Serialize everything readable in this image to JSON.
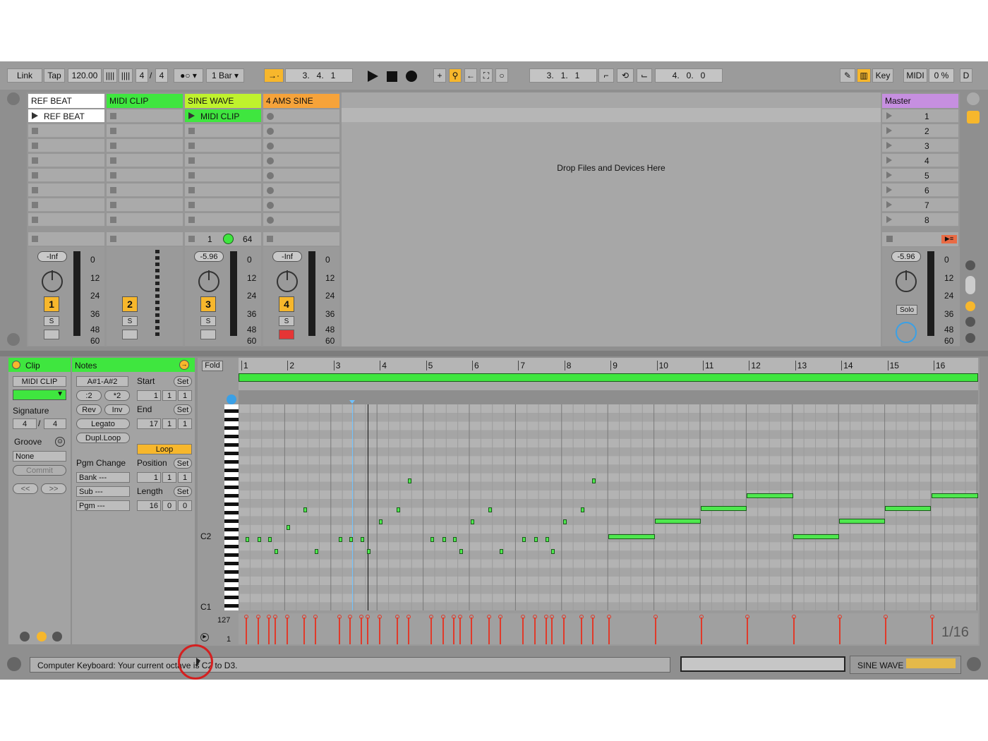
{
  "transport": {
    "link": "Link",
    "tap": "Tap",
    "tempo": "120.00",
    "sig_num": "4",
    "sig_den": "4",
    "quant": "1 Bar",
    "arrangement_pos": "3.   4.   1",
    "loop_start": "3.   1.   1",
    "loop_len": "4.   0.   0",
    "key": "Key",
    "midi": "MIDI",
    "cpu": "0 %",
    "d": "D"
  },
  "tracks": [
    {
      "name": "REF BEAT",
      "color": "#ffffff",
      "clip": "REF BEAT",
      "num": "1",
      "vol": "-Inf"
    },
    {
      "name": "MIDI CLIP",
      "color": "#3fe63f",
      "num": "2"
    },
    {
      "name": "SINE WAVE",
      "color": "#bff22d",
      "clip": "MIDI CLIP",
      "num": "3",
      "vol": "-5.96",
      "clipstop_a": "1",
      "clipstop_b": "64"
    },
    {
      "name": "4   AMS SINE",
      "color": "#f6a33a",
      "num": "4",
      "vol": "-Inf"
    }
  ],
  "drop_text": "Drop Files and Devices Here",
  "master": {
    "name": "Master",
    "color": "#c68fe0",
    "scenes": [
      "1",
      "2",
      "3",
      "4",
      "5",
      "6",
      "7",
      "8"
    ],
    "vol": "-5.96",
    "solo": "Solo"
  },
  "meter_scale": [
    "0",
    "12",
    "24",
    "36",
    "48",
    "60"
  ],
  "solo_label": "S",
  "clip_panel": {
    "title": "Clip",
    "name": "MIDI CLIP",
    "signature_label": "Signature",
    "sig_num": "4",
    "sig_den": "4",
    "groove_label": "Groove",
    "groove": "None",
    "commit": "Commit",
    "prev": "<<",
    "next": ">>"
  },
  "notes_panel": {
    "title": "Notes",
    "range": "A#1-A#2",
    "half": ":2",
    "double": "*2",
    "rev": "Rev",
    "inv": "Inv",
    "legato": "Legato",
    "dupl": "Dupl.Loop",
    "start": "Start",
    "set": "Set",
    "start_v": [
      "1",
      "1",
      "1"
    ],
    "end": "End",
    "end_v": [
      "17",
      "1",
      "1"
    ],
    "loop": "Loop",
    "position": "Position",
    "pos_v": [
      "1",
      "1",
      "1"
    ],
    "length": "Length",
    "len_v": [
      "16",
      "0",
      "0"
    ],
    "pgm_change": "Pgm Change",
    "bank": "Bank ---",
    "sub": "Sub ---",
    "pgm": "Pgm ---"
  },
  "editor": {
    "fold": "Fold",
    "bars": [
      "1",
      "2",
      "3",
      "4",
      "5",
      "6",
      "7",
      "8",
      "9",
      "10",
      "11",
      "12",
      "13",
      "14",
      "15",
      "16"
    ],
    "c2": "C2",
    "c1": "C1",
    "vel_max": "127",
    "vel_min": "1",
    "grid": "1/16"
  },
  "status": {
    "text": "Computer Keyboard: Your current octave is C2 to D3.",
    "track": "SINE WAVE"
  }
}
